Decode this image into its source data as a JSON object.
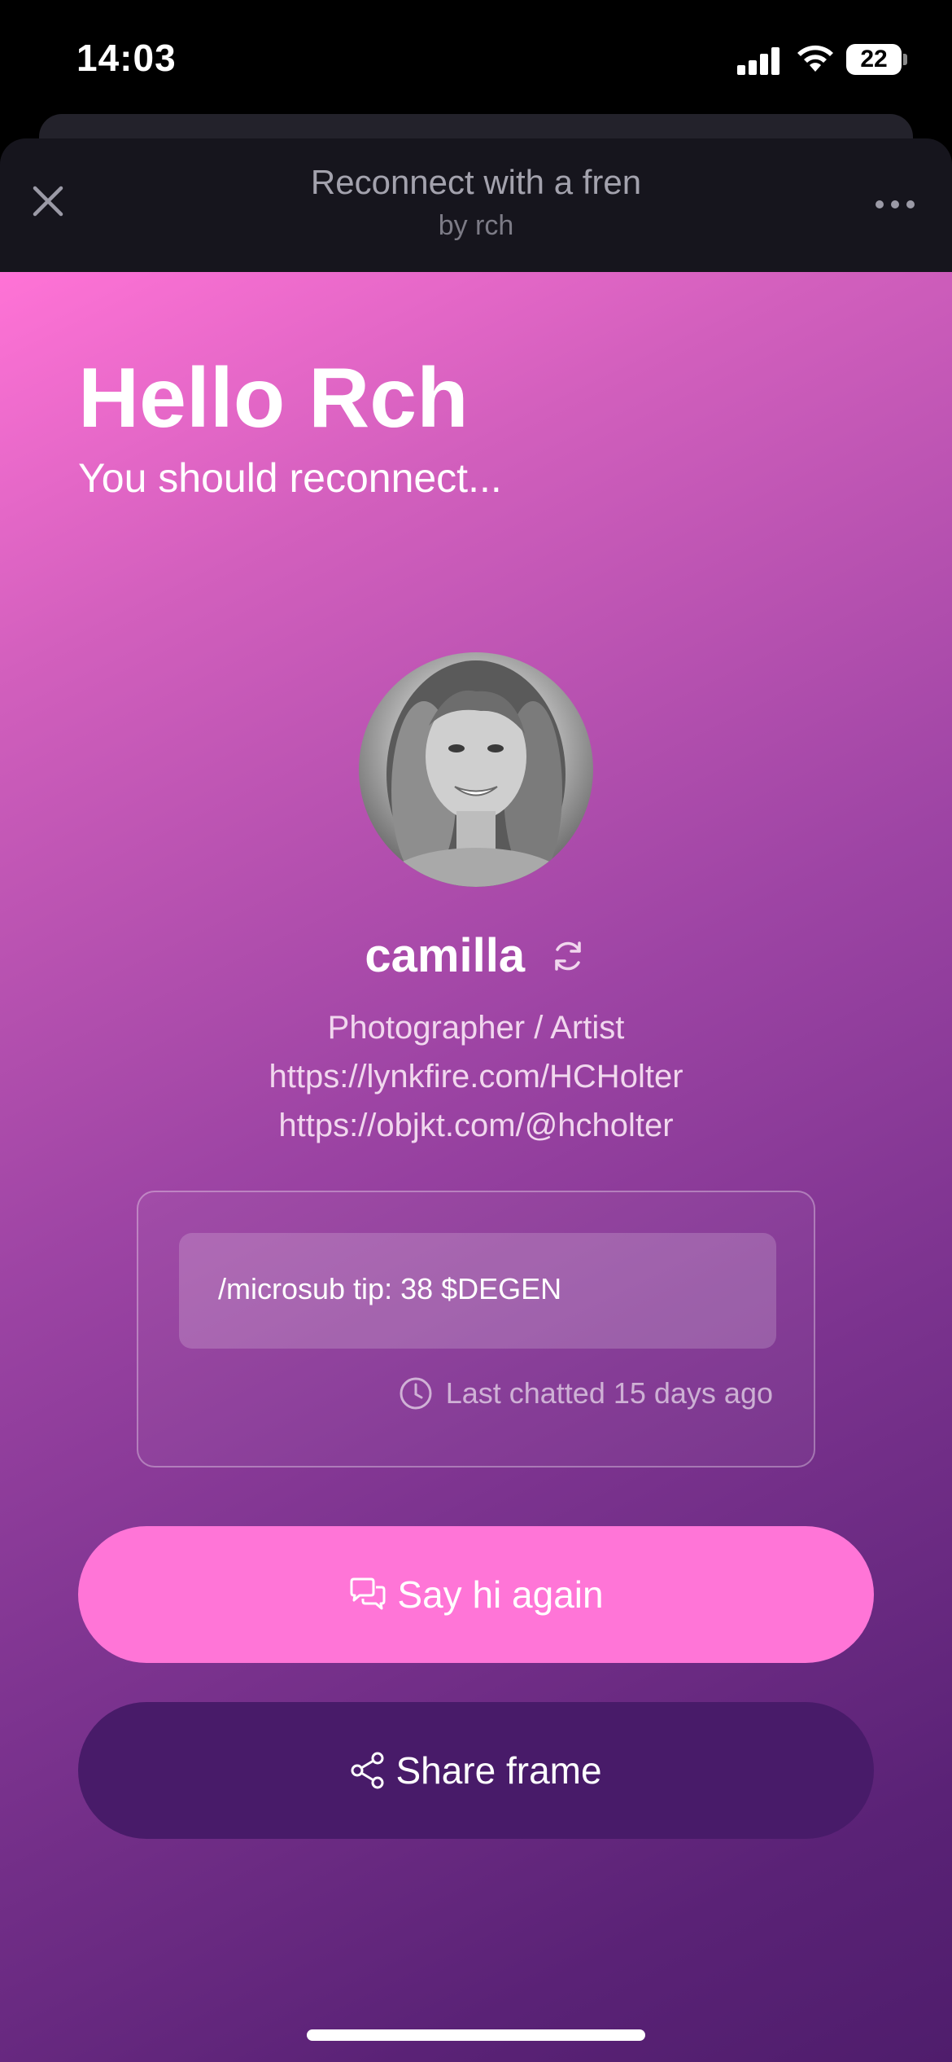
{
  "status_bar": {
    "time": "14:03",
    "battery": "22"
  },
  "header": {
    "title": "Reconnect with a fren",
    "subtitle": "by rch"
  },
  "frame": {
    "greeting": "Hello Rch",
    "subtitle": "You should reconnect...",
    "profile": {
      "name": "camilla",
      "bio": [
        "Photographer / Artist",
        "https://lynkfire.com/HCHolter",
        "https://objkt.com/@hcholter"
      ]
    },
    "chat": {
      "message": "/microsub tip: 38 $DEGEN",
      "last_chatted": "Last chatted 15 days ago"
    },
    "buttons": {
      "say_hi": "Say hi again",
      "share": "Share frame"
    }
  },
  "icons": {
    "close": "close-icon",
    "more": "more-icon",
    "refresh": "refresh-icon",
    "clock": "clock-icon",
    "chat": "chat-bubbles-icon",
    "share": "share-icon"
  },
  "colors": {
    "primary_button": "#ff75d7",
    "secondary_button": "#481b69",
    "header_bg": "#16151d"
  }
}
